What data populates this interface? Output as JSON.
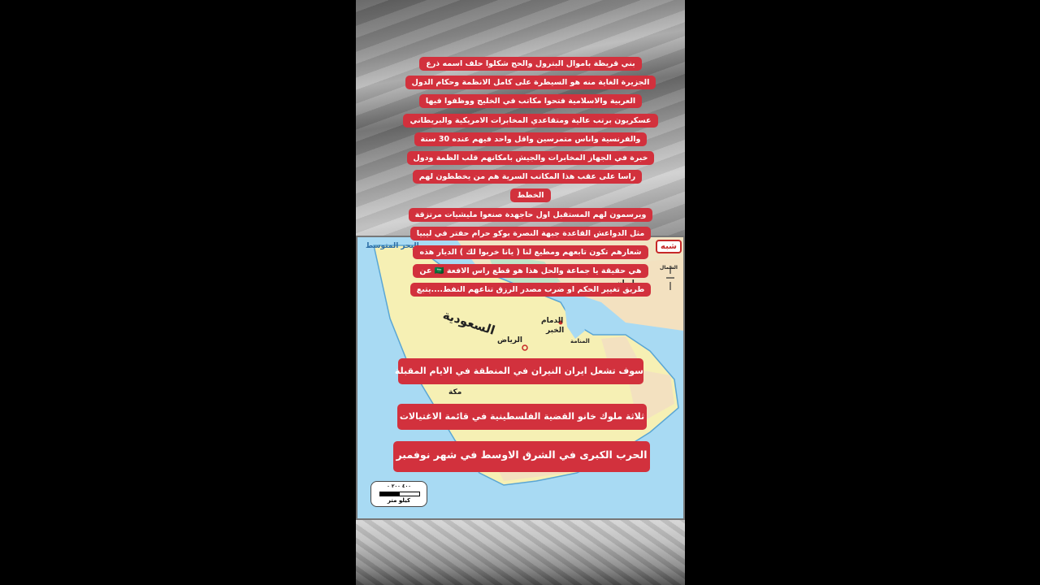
{
  "paragraph_lines": [
    "بني قريظة باموال البترول والحج شكلوا حلف اسمه ذرع",
    "الجزيرة الغاية منه هو السيطرة على كامل الانظمة وحكام الدول",
    "العربية والاسلامية فتحوا مكاتب في الخليج ووظفوا فيها",
    "عسكريون برتب عالية ومتقاعدي المخابرات الامريكية والبريطاني",
    "والفرنسية واناس متمرسين واقل واحد فيهم عنده 30 سنة",
    "خبرة في الجهاز المخابرات والجيش بامكانهم قلب الظمة ودول",
    "راسا على عقب هذا المكاتب السرية هم من يخططون لهم الخطط",
    "ويرسمون لهم المستقبل اول حاجهدة صنعوا مليشيات مرتزقة",
    "مثل الدواعش القاعدة جبهة النصرة بوكو حرام حفتر في ليبيا",
    "شعارهم تكون تابعهم ومطيع لنا ( يانا خربوا لك ) الديار هذه",
    "هي حقيقة يا جماعة والحل هذا هو قطع راس الافعة 🇸🇦 عن",
    "طريق تغيير الحكم او ضرب مصدر الرزق تناعهم النفط....يتبع"
  ],
  "banners": {
    "iran": "سوف تشعل ايران النيران في المنطقة في الايام المقبلة",
    "kings": "ثلاثة ملوك خانو القضية الفلسطينية في قائمة الاغتيالات",
    "war": "الحرب   الكبرى في الشرق الاوسط في شهر نوفمبر"
  },
  "map": {
    "title_badge": "شبه",
    "labels": {
      "sea_top_left": "البحر المتوسط",
      "iran": "إيران",
      "north": "الشمال",
      "riyadh": "الرياض",
      "dammam": "الدمام",
      "khobar": "الخبر",
      "manama": "المنامة",
      "saudi": "السعودية",
      "makkah": "مكة"
    },
    "scale": {
      "numbers": "٤٠٠   ٢٠٠   ٠",
      "unit": "كيلو متر"
    }
  },
  "colors": {
    "banner_red": "#d2313d",
    "land": "#f6f0b4",
    "sea": "#a8daf3"
  }
}
